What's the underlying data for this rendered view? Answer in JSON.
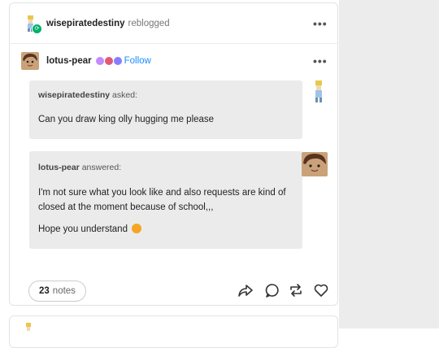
{
  "post": {
    "reblogger": {
      "username": "wisepiratedestiny",
      "action": "reblogged"
    },
    "author": {
      "username": "lotus-pear",
      "follow_label": "Follow",
      "badge_colors": [
        "#c28bff",
        "#e05a78",
        "#8a7cff"
      ]
    },
    "ask": {
      "asker": "wisepiratedestiny",
      "asked_label": "asked:",
      "question": "Can you draw king olly hugging me please"
    },
    "answer": {
      "answerer": "lotus-pear",
      "answered_label": "answered:",
      "paragraph1": "I'm not sure what you look like and also requests are kind of closed at the moment because of school,,,",
      "paragraph2": "Hope you understand"
    },
    "notes": {
      "count": "23",
      "label": "notes"
    },
    "more_label": "•••"
  },
  "colors": {
    "link": "#1a8cff",
    "reblog_badge": "#00b16a",
    "sidebar": "#ececec"
  },
  "icons": [
    "share-icon",
    "reply-icon",
    "reblog-icon",
    "like-icon",
    "sad-face-emoji"
  ]
}
